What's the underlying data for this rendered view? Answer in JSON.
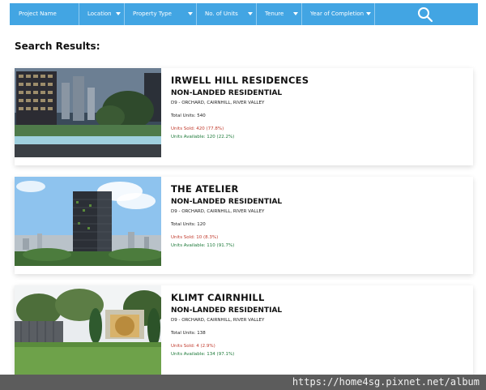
{
  "filters": {
    "project_name": "Project Name",
    "location": "Location",
    "property_type": "Property Type",
    "units": "No. of Units",
    "tenure": "Tenure",
    "year": "Year of Completion"
  },
  "colors": {
    "filter_bar": "#42a5e3",
    "sold": "#c0392b",
    "available": "#1e7a3a"
  },
  "results_title": "Search Results:",
  "results": [
    {
      "name": "IRWELL HILL RESIDENCES",
      "type": "NON-LANDED RESIDENTIAL",
      "location": "D9 - ORCHARD, CAIRNHILL, RIVER VALLEY",
      "total": "Total Units: 540",
      "sold": "Units Sold: 420 (77.8%)",
      "available": "Units Available: 120 (22.2%)"
    },
    {
      "name": "THE ATELIER",
      "type": "NON-LANDED RESIDENTIAL",
      "location": "D9 - ORCHARD, CAIRNHILL, RIVER VALLEY",
      "total": "Total Units: 120",
      "sold": "Units Sold: 10 (8.3%)",
      "available": "Units Available: 110 (91.7%)"
    },
    {
      "name": "KLIMT CAIRNHILL",
      "type": "NON-LANDED RESIDENTIAL",
      "location": "D9 - ORCHARD, CAIRNHILL, RIVER VALLEY",
      "total": "Total Units: 138",
      "sold": "Units Sold: 4 (2.9%)",
      "available": "Units Available: 134 (97.1%)"
    }
  ],
  "watermark": "https://home4sg.pixnet.net/album"
}
